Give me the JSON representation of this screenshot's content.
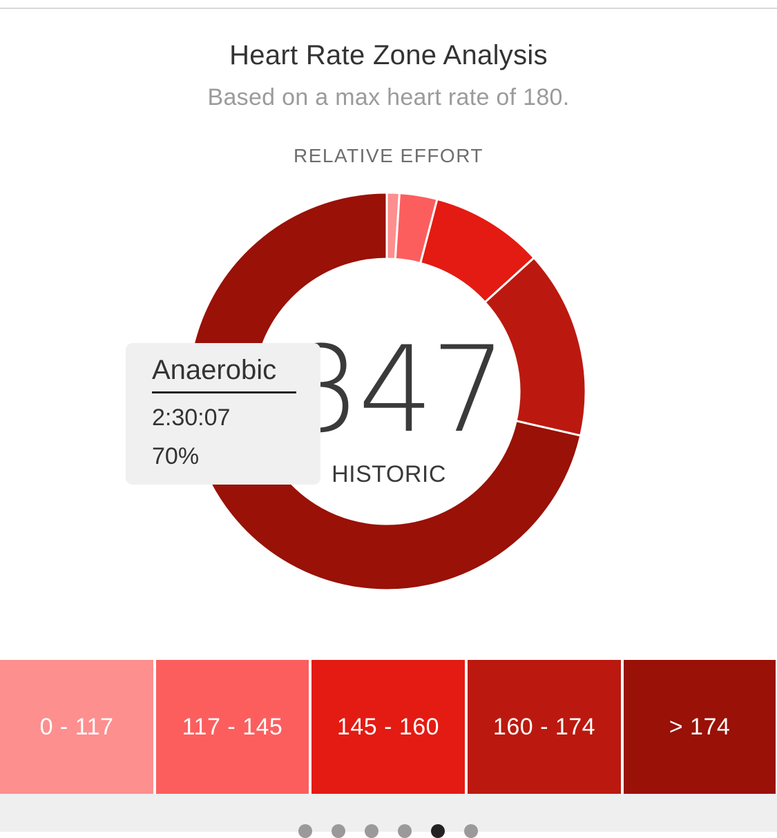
{
  "header": {
    "title": "Heart Rate Zone Analysis",
    "subtitle": "Based on a max heart rate of 180.",
    "section_label": "RELATIVE EFFORT"
  },
  "center": {
    "value": "347",
    "label": "HISTORIC"
  },
  "tooltip": {
    "zone_name": "Anaerobic",
    "duration": "2:30:07",
    "percent": "70%"
  },
  "chart_data": {
    "type": "pie",
    "style": "donut",
    "categories": [
      "0 - 117",
      "117 - 145",
      "145 - 160",
      "160 - 174",
      "> 174"
    ],
    "values": [
      1,
      3,
      9,
      15,
      70
    ],
    "unit": "percent of time",
    "colors": [
      "#fd8f8f",
      "#fc5e5e",
      "#e41b12",
      "#bb190f",
      "#991107"
    ],
    "start_angle_deg": 0,
    "direction": "clockwise"
  },
  "zones": [
    {
      "label": "0 - 117",
      "color": "#fd8f8f"
    },
    {
      "label": "117 - 145",
      "color": "#fc5e5e"
    },
    {
      "label": "145 - 160",
      "color": "#e41b12"
    },
    {
      "label": "160 - 174",
      "color": "#bb190f"
    },
    {
      "label": "> 174",
      "color": "#991107"
    }
  ],
  "pager": {
    "count": 6,
    "active_index": 4
  }
}
